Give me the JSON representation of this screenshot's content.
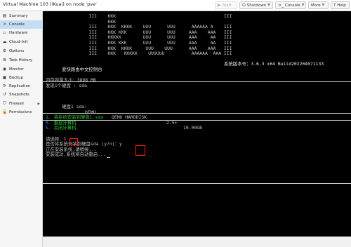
{
  "header": {
    "title": "Virtual Machine 103 (iKuai) on node 'pve'",
    "buttons": {
      "start": "Start",
      "shutdown": "Shutdown",
      "console": "Console",
      "more": "More",
      "help": "Help"
    }
  },
  "sidebar": {
    "items": [
      {
        "label": "Summary",
        "icon": "summary-icon"
      },
      {
        "label": "Console",
        "icon": "console-icon"
      },
      {
        "label": "Hardware",
        "icon": "hardware-icon"
      },
      {
        "label": "Cloud-Init",
        "icon": "cloud-icon"
      },
      {
        "label": "Options",
        "icon": "gear-icon"
      },
      {
        "label": "Task History",
        "icon": "list-icon"
      },
      {
        "label": "Monitor",
        "icon": "eye-icon"
      },
      {
        "label": "Backup",
        "icon": "floppy-icon"
      },
      {
        "label": "Replication",
        "icon": "sync-icon"
      },
      {
        "label": "Snapshots",
        "icon": "history-icon"
      },
      {
        "label": "Firewall",
        "icon": "shield-icon"
      },
      {
        "label": "Permissions",
        "icon": "unlock-icon"
      }
    ],
    "selected": "Console"
  },
  "terminal": {
    "banner": [
      "                III    KKK                                        III",
      "                       KKK                                           ",
      "                III    KKK  KKKK    UUU      UUU      AAAAAA A    III",
      "                III    KKK KKK      UUU      UUU     AAA    AAA   III",
      "                III    KKKKK        UUU      UUU     AAA     AA   III",
      "                III    KKK KKK      UUU      UUU     AAA     AA   III",
      "                III    KKK  KKKK     UUU    UUU      AAA    AAA   III",
      "                III    KKK   KKKKK    UUUUUU          AAAAAA  AAA III"
    ],
    "console_name": "爱快路由中文控制台",
    "version_label": "系统版本号：",
    "version": "3.6.3 x64 Build202204071133",
    "memory_label": "内存容量大小：",
    "memory": "3898 MB",
    "disk_found": "发现1个硬盘 : sda",
    "disk_row": {
      "name": "硬盘1 sda:",
      "vendor": "QEMU",
      "model": "QEMU HARDDISK",
      "size": "2.5+",
      "capacity": "10.00GB"
    },
    "menu": [
      {
        "key": "1.",
        "text": "将系统安装到硬盘1 sda"
      },
      {
        "key": "R.",
        "text": "重启计算机"
      },
      {
        "key": "S.",
        "text": "关闭计算机"
      }
    ],
    "prompt_label": "请选择：",
    "prompt_value": "1",
    "confirm_text": "是否将系统安装到硬盘sda (y/n)：",
    "confirm_value": "y",
    "installing": "正在安装系统,请稍候...",
    "done": "安装成功,系统将自动重启..."
  }
}
